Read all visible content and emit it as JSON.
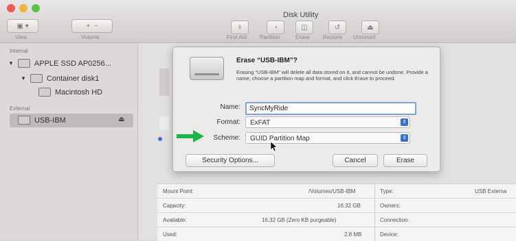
{
  "window": {
    "title": "Disk Utility",
    "toolbar": {
      "view_label": "View",
      "volume_label": "Volume",
      "first_aid": "First Aid",
      "partition": "Partition",
      "erase": "Erase",
      "restore": "Restore",
      "unmount": "Unmount"
    }
  },
  "sidebar": {
    "internal_header": "Internal",
    "external_header": "External",
    "items": [
      {
        "label": "APPLE SSD AP0256..."
      },
      {
        "label": "Container disk1"
      },
      {
        "label": "Macintosh HD"
      },
      {
        "label": "USB-IBM"
      }
    ]
  },
  "dialog": {
    "title": "Erase “USB-IBM”?",
    "message": "Erasing “USB-IBM” will delete all data stored on it, and cannot be undone. Provide a name, choose a partition map and format, and click Erase to proceed.",
    "name_label": "Name:",
    "name_value": "SyncMyRide",
    "format_label": "Format:",
    "format_value": "ExFAT",
    "scheme_label": "Scheme:",
    "scheme_value": "GUID Partition Map",
    "security_button": "Security Options...",
    "cancel_button": "Cancel",
    "erase_button": "Erase"
  },
  "info": {
    "rows": [
      {
        "label": "Mount Point:",
        "value": "/Volumes/USB-IBM",
        "right_label": "Type:",
        "right_value": "USB Externa"
      },
      {
        "label": "Capacity:",
        "value": "16.32 GB",
        "right_label": "Owners:",
        "right_value": ""
      },
      {
        "label": "Available:",
        "value": "16.32 GB (Zero KB purgeable)",
        "right_label": "Connection:",
        "right_value": ""
      },
      {
        "label": "Used:",
        "value": "2.8 MB",
        "right_label": "Device:",
        "right_value": ""
      }
    ]
  },
  "colors": {
    "accent": "#3b6fd6",
    "arrow": "#1fb34a"
  }
}
